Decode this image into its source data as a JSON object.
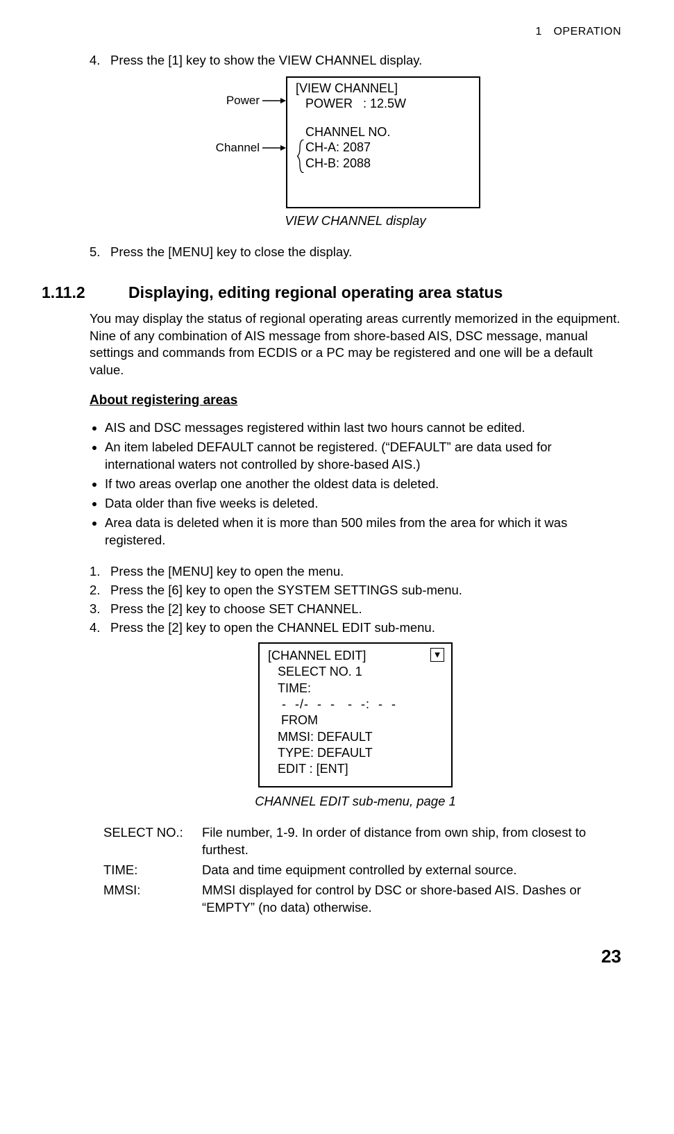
{
  "runningHeader": "1 OPERATION",
  "step4": {
    "num": "4.",
    "text": "Press the [1] key to show the VIEW CHANNEL display."
  },
  "vchLabels": {
    "power": "Power",
    "channel": "Channel"
  },
  "vchBox": {
    "title": "[VIEW CHANNEL]",
    "power": "POWER   : 12.5W",
    "chHead": "CHANNEL NO.",
    "chA": "CH-A: 2087",
    "chB": "CH-B: 2088"
  },
  "fig1": "VIEW CHANNEL display",
  "step5": {
    "num": "5.",
    "text": "Press the [MENU] key to close the display."
  },
  "sec": {
    "num": "1.11.2",
    "title": "Displaying, editing regional operating area status"
  },
  "para1": "You may display the status of regional operating areas currently memorized in the equipment. Nine of any combination of AIS message from shore-based AIS, DSC message, manual settings and commands from ECDIS or a PC may be registered and one will be a default value.",
  "subhead": "About registering areas",
  "rules": {
    "r1": "AIS and DSC messages registered within last two hours cannot be edited.",
    "r2": "An item labeled DEFAULT cannot be registered. (“DEFAULT” are data used for international waters not controlled by shore-based AIS.)",
    "r3": "If two areas overlap one another the oldest data is deleted.",
    "r4": "Data older than five weeks is deleted.",
    "r5": "Area data is deleted when it is more than 500 miles from the area for which it was registered."
  },
  "steps2": {
    "s1": {
      "num": "1.",
      "text": "Press the [MENU] key to open the menu."
    },
    "s2": {
      "num": "2.",
      "text": "Press the [6] key to open the SYSTEM SETTINGS sub-menu."
    },
    "s3": {
      "num": "3.",
      "text": "Press the [2] key to choose SET CHANNEL."
    },
    "s4": {
      "num": "4.",
      "text": "Press the [2] key to open the CHANNEL EDIT sub-menu."
    }
  },
  "ceBox": {
    "title": "[CHANNEL EDIT]",
    "l1": "SELECT NO. 1",
    "l2": "TIME:",
    "l3": " -  -/-  -  -   -  -:  -  -",
    "l4": " FROM",
    "l5": "MMSI: DEFAULT",
    "l6": "TYPE: DEFAULT",
    "l7": "EDIT : [ENT]"
  },
  "fig2": "CHANNEL EDIT sub-menu, page 1",
  "defs": {
    "d1": {
      "term": "SELECT NO.:",
      "text": "File number, 1-9. In order of distance from own ship, from closest to furthest."
    },
    "d2": {
      "term": "TIME:",
      "text": "Data and time equipment controlled by external source."
    },
    "d3": {
      "term": "MMSI:",
      "text": "MMSI displayed for control by DSC or shore-based AIS. Dashes or “EMPTY” (no data) otherwise."
    }
  },
  "pageNumber": "23"
}
